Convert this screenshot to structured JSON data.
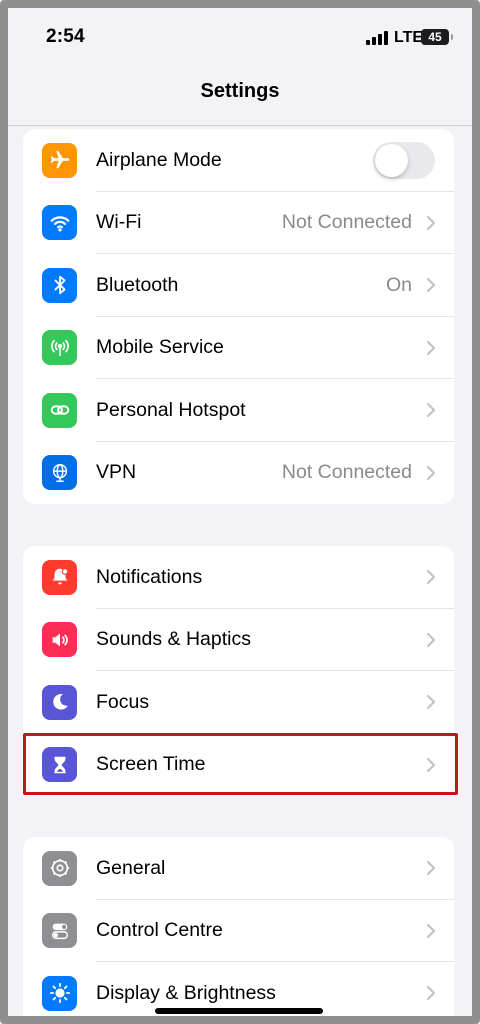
{
  "status_bar": {
    "time": "2:54",
    "network": "LTE",
    "battery": "45"
  },
  "nav": {
    "title": "Settings"
  },
  "groups": [
    {
      "items": [
        {
          "label": "Airplane Mode",
          "icon": "airplane-icon",
          "color": "#ff9500",
          "control": "toggle",
          "toggle_on": false
        },
        {
          "label": "Wi-Fi",
          "icon": "wifi-icon",
          "color": "#007aff",
          "value": "Not Connected"
        },
        {
          "label": "Bluetooth",
          "icon": "bluetooth-icon",
          "color": "#007aff",
          "value": "On"
        },
        {
          "label": "Mobile Service",
          "icon": "antenna-icon",
          "color": "#34c759"
        },
        {
          "label": "Personal Hotspot",
          "icon": "hotspot-icon",
          "color": "#34c759"
        },
        {
          "label": "VPN",
          "icon": "globe-icon",
          "color": "#006ee6",
          "value": "Not Connected"
        }
      ]
    },
    {
      "items": [
        {
          "label": "Notifications",
          "icon": "bell-icon",
          "color": "#ff3b30"
        },
        {
          "label": "Sounds & Haptics",
          "icon": "speaker-icon",
          "color": "#ff2d55"
        },
        {
          "label": "Focus",
          "icon": "moon-icon",
          "color": "#5856d6"
        },
        {
          "label": "Screen Time",
          "icon": "hourglass-icon",
          "color": "#5856d6",
          "highlighted": true
        }
      ]
    },
    {
      "items": [
        {
          "label": "General",
          "icon": "gear-icon",
          "color": "#8e8e93"
        },
        {
          "label": "Control Centre",
          "icon": "switches-icon",
          "color": "#8e8e93"
        },
        {
          "label": "Display & Brightness",
          "icon": "sun-icon",
          "color": "#007aff"
        }
      ]
    }
  ]
}
